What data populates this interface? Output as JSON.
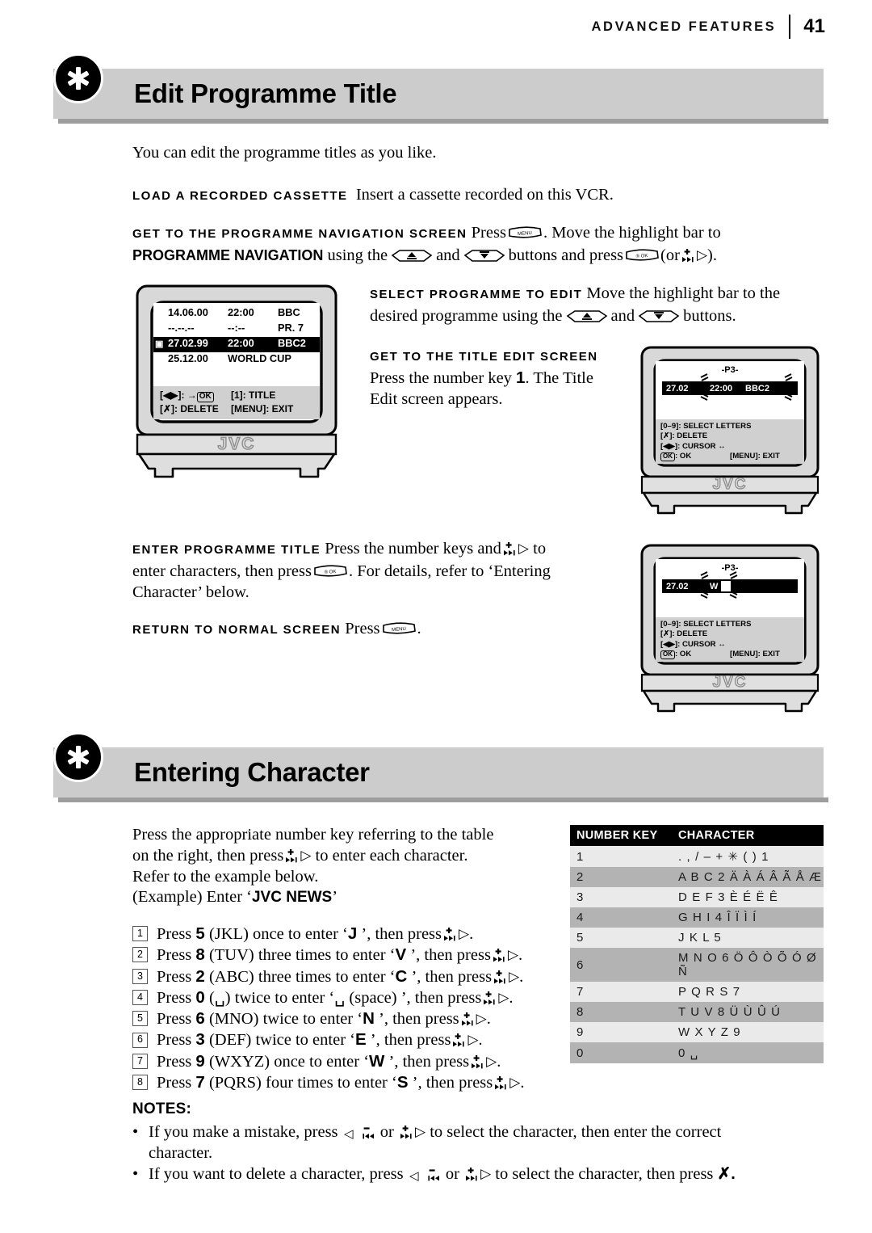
{
  "running_head": {
    "label": "ADVANCED FEATURES",
    "page_number": "41"
  },
  "section1": {
    "badge_icon": "asterisk-icon",
    "title": "Edit Programme Title",
    "intro": "You can edit the programme titles as you like.",
    "steps": [
      {
        "lead": "LOAD A RECORDED CASSETTE",
        "body": "Insert a cassette recorded on this VCR."
      },
      {
        "lead": "GET TO THE PROGRAMME NAVIGATION SCREEN",
        "body_a": "Press",
        "body_b": ". Move the highlight bar to",
        "body_c": "PROGRAMME NAVIGATION",
        "body_d": "using the",
        "body_e": "and",
        "body_f": "buttons and press",
        "body_g": "(or",
        "body_h": ")."
      },
      {
        "lead": "SELECT PROGRAMME TO EDIT",
        "body_a": "Move the highlight bar to the",
        "body_b": "desired programme using the",
        "body_c": "and",
        "body_d": "buttons."
      },
      {
        "lead": "GET TO THE TITLE EDIT SCREEN",
        "body_a": "Press the number key",
        "body_key": "1",
        "body_b": ". The Title",
        "body_c": "Edit screen appears."
      },
      {
        "lead": "ENTER PROGRAMME TITLE",
        "body_a": "Press the number keys and",
        "body_b": "to",
        "body_c": "enter characters, then press",
        "body_d": ". For details, refer to ‘Entering",
        "body_e": "Character’ below."
      },
      {
        "lead": "RETURN TO NORMAL SCREEN",
        "body_a": "Press",
        "body_b": "."
      }
    ]
  },
  "tv_nav": {
    "brand": "JVC",
    "rows": [
      {
        "date": "14.06.00",
        "time": "22:00",
        "channel": "BBC"
      },
      {
        "date": "--.--.--",
        "time": "--:--",
        "channel": "PR. 7"
      },
      {
        "date": "27.02.99",
        "time": "22:00",
        "channel": "BBC2",
        "highlight": true,
        "icon": "cassette-icon"
      },
      {
        "date": "25.12.00",
        "time": "WORLD CUP",
        "channel": ""
      }
    ],
    "footer": {
      "cursor": "[◀▶]: →",
      "cursor_ok": "OK",
      "title_key": "[1]: TITLE",
      "delete": "[✗]: DELETE",
      "exit": "[MENU]: EXIT"
    }
  },
  "tv_edit_1": {
    "brand": "JVC",
    "header": "-P3-",
    "bar_date": "27.02",
    "bar_time": "22:00",
    "bar_channel": "BBC2",
    "footer": {
      "select": "[0–9]: SELECT LETTERS",
      "delete": "[✗]: DELETE",
      "cursor": "[◀▶]: CURSOR ↔",
      "ok_box": "OK",
      "ok_label": ": OK",
      "exit": "[MENU]: EXIT"
    }
  },
  "tv_edit_2": {
    "brand": "JVC",
    "header": "-P3-",
    "bar_date": "27.02",
    "bar_char": "W",
    "footer": {
      "select": "[0–9]: SELECT LETTERS",
      "delete": "[✗]: DELETE",
      "cursor": "[◀▶]: CURSOR ↔",
      "ok_box": "OK",
      "ok_label": ": OK",
      "exit": "[MENU]: EXIT"
    }
  },
  "section2": {
    "badge_icon": "asterisk-icon",
    "title": "Entering Character",
    "intro_a": "Press the appropriate number key referring to the table",
    "intro_b": "on the right, then press",
    "intro_c": "to enter each character.",
    "intro_d": "Refer to the example below.",
    "example_prefix": "(Example) Enter ‘",
    "example_value": "JVC NEWS",
    "example_suffix": "’",
    "steps": [
      {
        "num": "1",
        "a": "Press",
        "key": "5",
        "b": "(JKL) once to enter ‘",
        "ch": "J",
        "c": "’, then press",
        "d": "."
      },
      {
        "num": "2",
        "a": "Press",
        "key": "8",
        "b": "(TUV) three times to enter ‘",
        "ch": "V",
        "c": "’, then press",
        "d": "."
      },
      {
        "num": "3",
        "a": "Press",
        "key": "2",
        "b": "(ABC) three times to enter ‘",
        "ch": "C",
        "c": "’, then press",
        "d": "."
      },
      {
        "num": "4",
        "a": "Press",
        "key": "0",
        "b": "(␣) twice to enter ‘␣ (space) ’, then press",
        "ch": "",
        "c": "",
        "d": "."
      },
      {
        "num": "5",
        "a": "Press",
        "key": "6",
        "b": "(MNO) twice to enter ‘",
        "ch": "N",
        "c": "’, then press",
        "d": "."
      },
      {
        "num": "6",
        "a": "Press",
        "key": "3",
        "b": "(DEF) twice to enter ‘",
        "ch": "E",
        "c": "’, then press",
        "d": "."
      },
      {
        "num": "7",
        "a": "Press",
        "key": "9",
        "b": "(WXYZ) once to enter ‘",
        "ch": "W",
        "c": "’, then press",
        "d": "."
      },
      {
        "num": "8",
        "a": "Press",
        "key": "7",
        "b": "(PQRS) four times to enter ‘",
        "ch": "S",
        "c": "’, then press",
        "d": "."
      }
    ]
  },
  "character_table": {
    "headers": [
      "NUMBER KEY",
      "CHARACTER"
    ],
    "rows": [
      {
        "key": "1",
        "chars": ". , / – + ✳ ( ) 1"
      },
      {
        "key": "2",
        "chars": "A B C 2 Ä À Á Â Ã Å Æ"
      },
      {
        "key": "3",
        "chars": "D E F 3 È É Ë Ê"
      },
      {
        "key": "4",
        "chars": "G H I 4 Î Ï Ì Í"
      },
      {
        "key": "5",
        "chars": "J K L 5"
      },
      {
        "key": "6",
        "chars": "M N O 6 Ö Ô Ò Õ Ó Ø Ñ"
      },
      {
        "key": "7",
        "chars": "P Q R S 7"
      },
      {
        "key": "8",
        "chars": "T U V 8 Ü Ù Û Ú"
      },
      {
        "key": "9",
        "chars": "W X Y Z 9"
      },
      {
        "key": "0",
        "chars": "0 ␣"
      }
    ]
  },
  "notes": {
    "heading": "NOTES:",
    "items": [
      {
        "a": "If you make a mistake, press",
        "b": "or",
        "c": "to select the character, then enter the correct",
        "d": "character."
      },
      {
        "a": "If you want to delete a character, press",
        "b": "or",
        "c": "to select the character, then press",
        "d": "✗."
      }
    ]
  },
  "colors": {
    "banner_gray": "#cccccc",
    "banner_shadow": "#9d9d9d",
    "tv_body": "#d8d8d8",
    "osd_footer": "#d0d0d0",
    "table_odd": "#eaeaea",
    "table_even": "#b3b3b3"
  }
}
